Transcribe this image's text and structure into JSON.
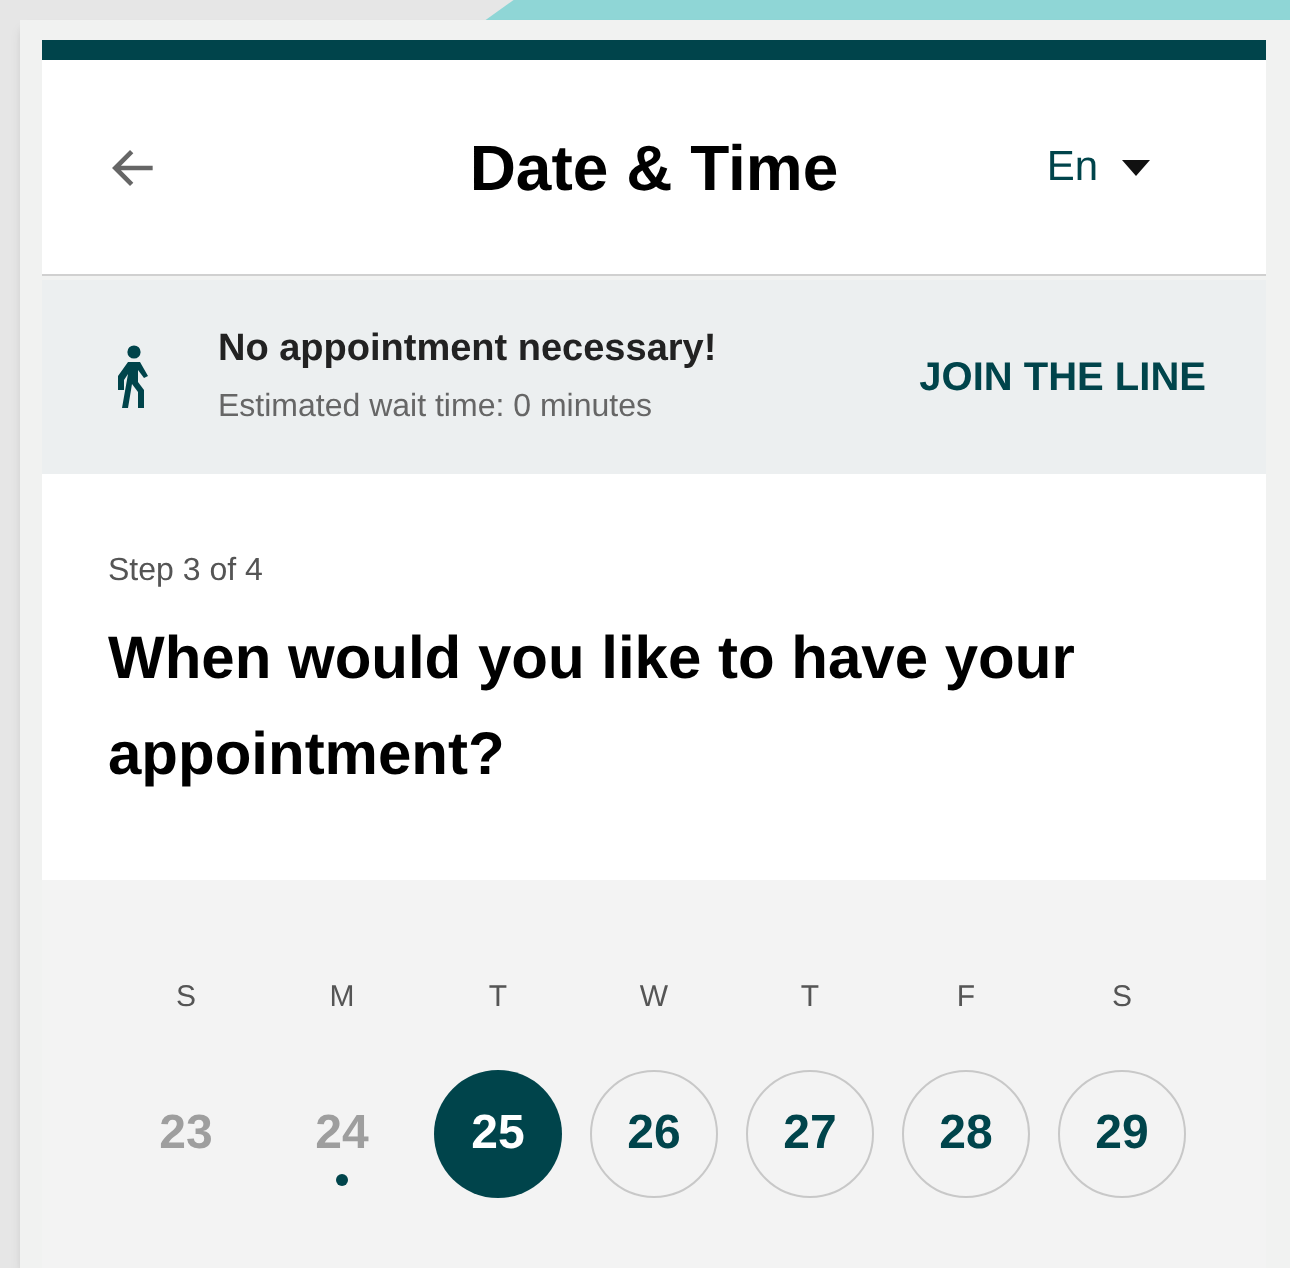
{
  "header": {
    "title": "Date & Time",
    "language": "En"
  },
  "banner": {
    "title": "No appointment necessary!",
    "subtitle": "Estimated wait time: 0 minutes",
    "action": "JOIN THE LINE"
  },
  "step": "Step 3 of 4",
  "question": "When would you like to have your appointment?",
  "calendar": {
    "weekdays": [
      "S",
      "M",
      "T",
      "W",
      "T",
      "F",
      "S"
    ],
    "days": [
      {
        "label": "23",
        "disabled": true,
        "selected": false,
        "today": false
      },
      {
        "label": "24",
        "disabled": true,
        "selected": false,
        "today": true
      },
      {
        "label": "25",
        "disabled": false,
        "selected": true,
        "today": false
      },
      {
        "label": "26",
        "disabled": false,
        "selected": false,
        "today": false
      },
      {
        "label": "27",
        "disabled": false,
        "selected": false,
        "today": false
      },
      {
        "label": "28",
        "disabled": false,
        "selected": false,
        "today": false
      },
      {
        "label": "29",
        "disabled": false,
        "selected": false,
        "today": false
      }
    ]
  }
}
